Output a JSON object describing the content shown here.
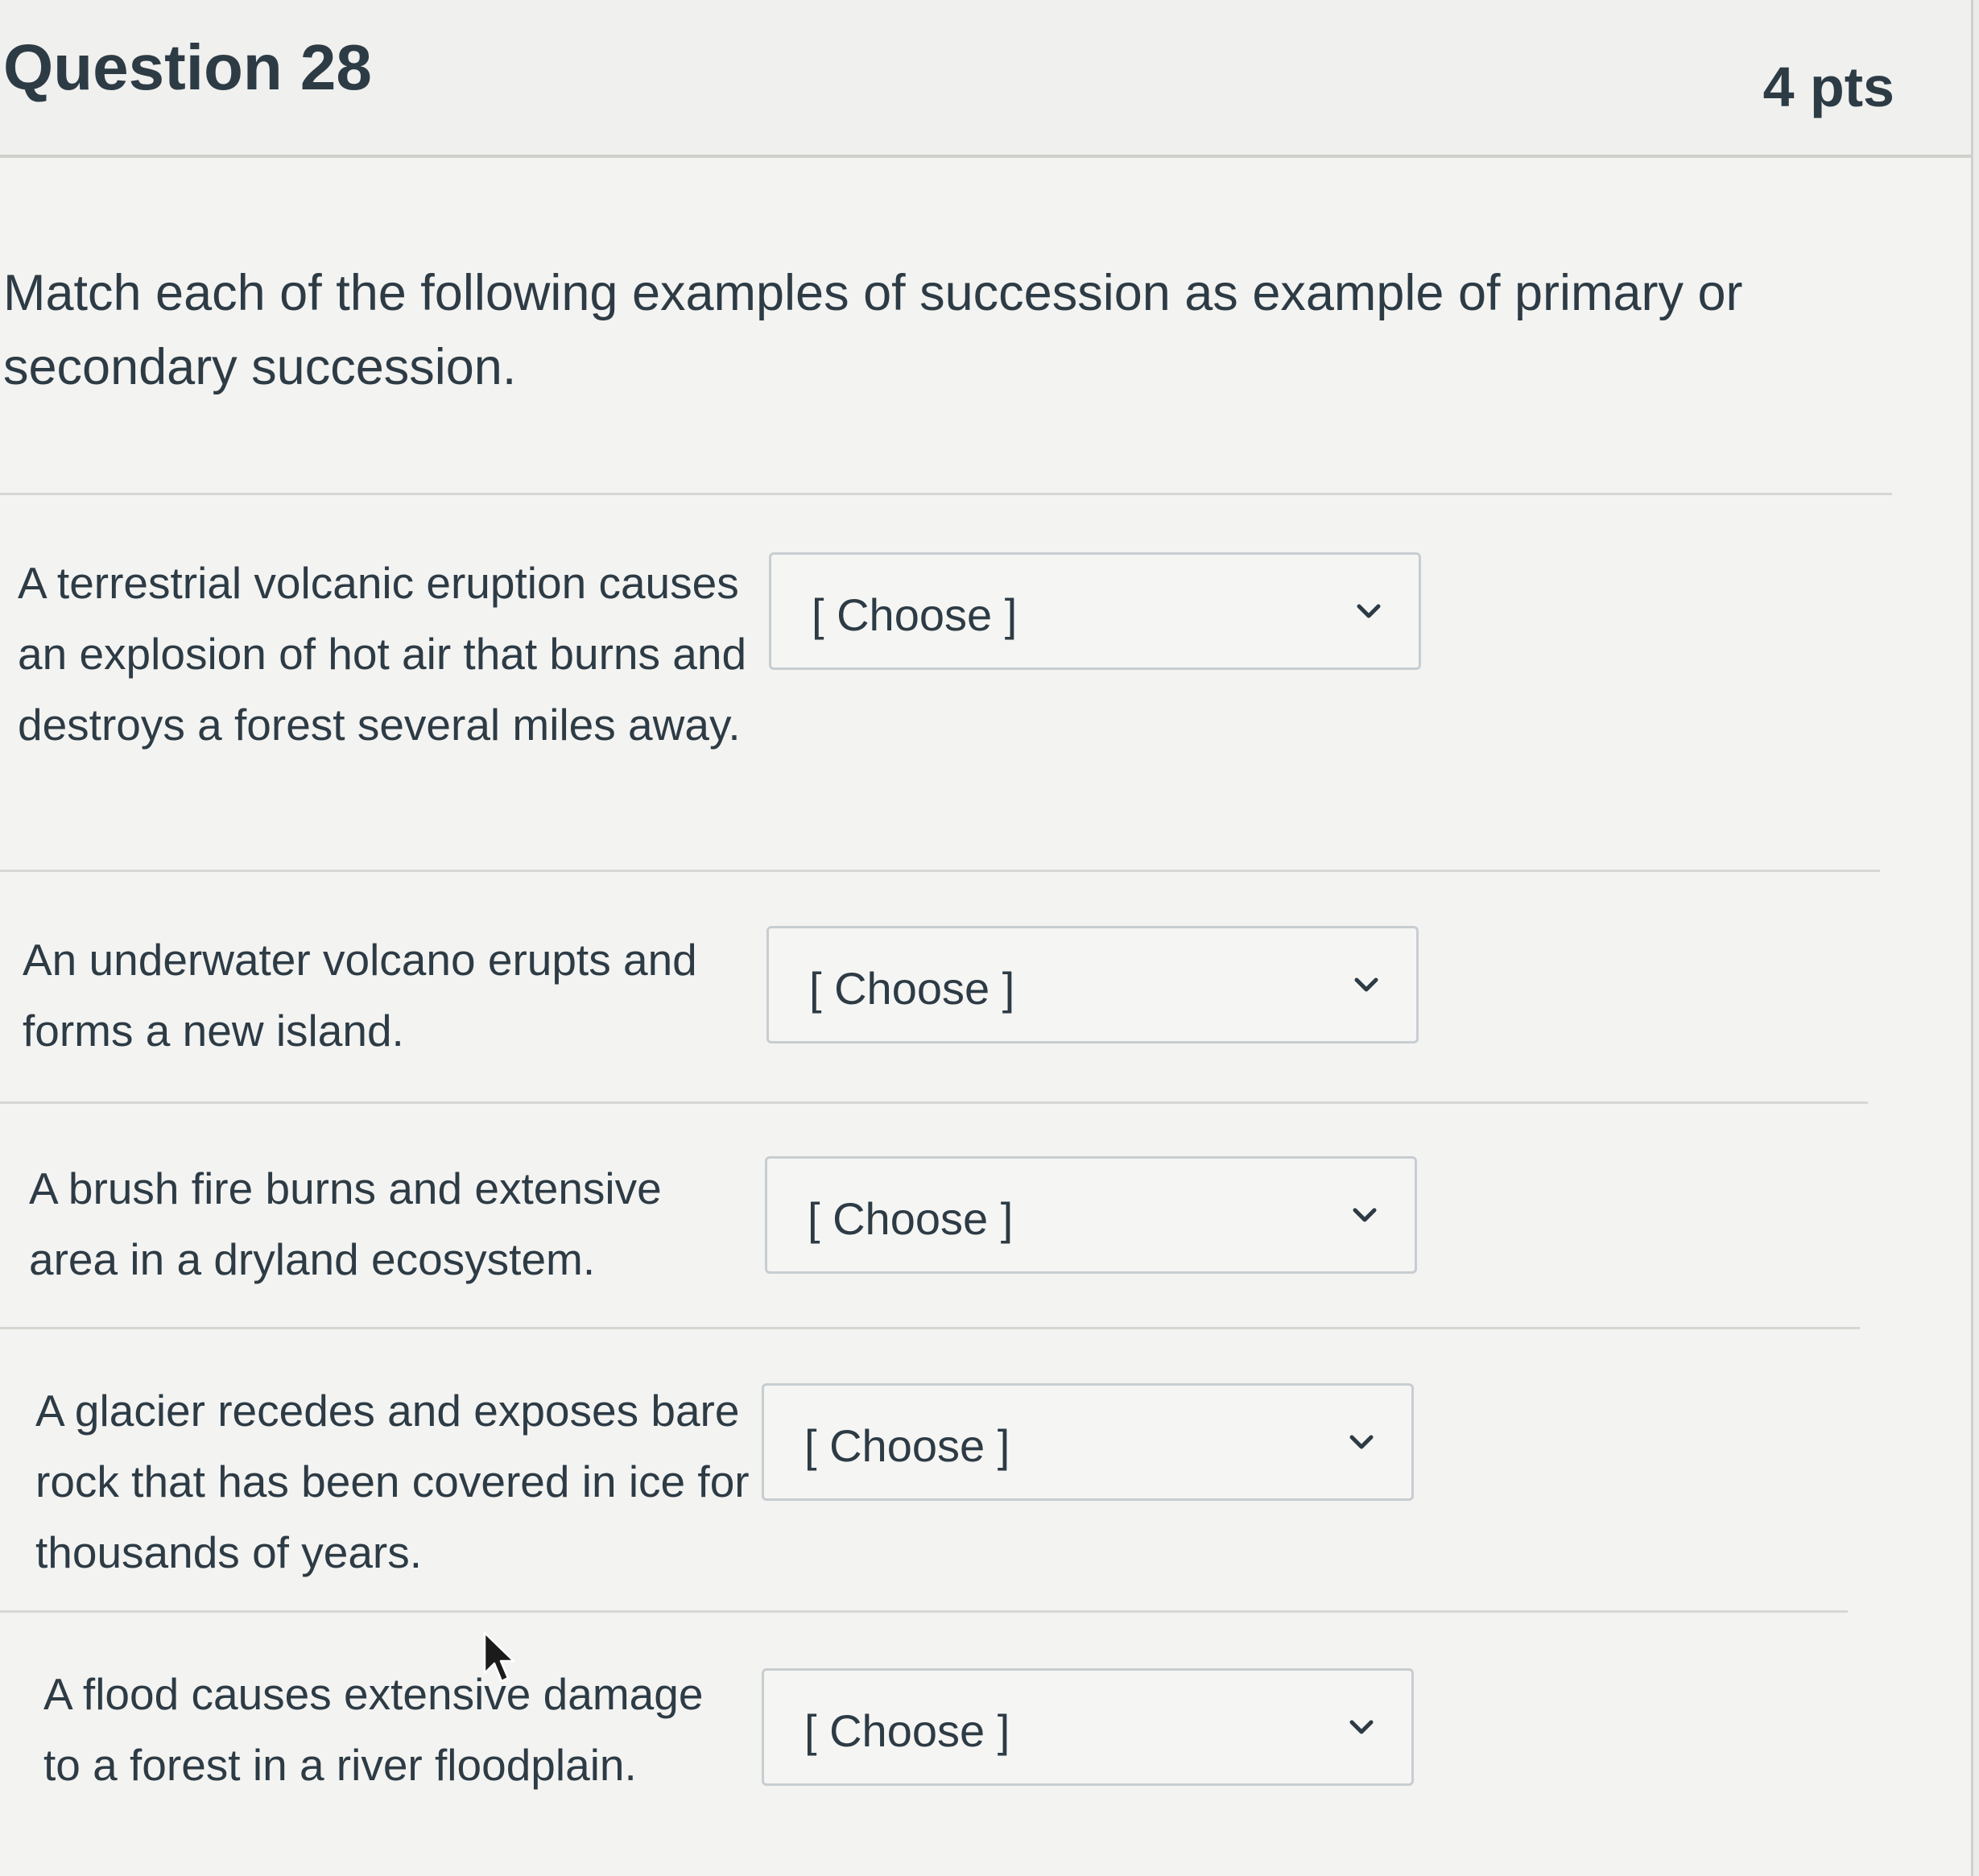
{
  "question": {
    "title": "Question 28",
    "points": "4 pts",
    "prompt": "Match each of the following examples of succession as example of primary or secondary succession."
  },
  "answers": [
    {
      "label": "A terrestrial volcanic eruption causes an explosion of hot air that burns and destroys a forest several miles away.",
      "selected": "[ Choose ]"
    },
    {
      "label": "An underwater volcano erupts and forms a new island.",
      "selected": "[ Choose ]"
    },
    {
      "label": "A brush fire burns and extensive area in a dryland ecosystem.",
      "selected": "[ Choose ]"
    },
    {
      "label": "A glacier recedes and exposes bare rock that has been covered in ice for thousands of years.",
      "selected": "[ Choose ]"
    },
    {
      "label": "A flood causes extensive damage to a forest in a river floodplain.",
      "selected": "[ Choose ]"
    }
  ],
  "icons": {
    "dropdown": "chevron-down-icon",
    "cursor": "mouse-pointer-icon"
  },
  "colors": {
    "text": "#2d3b45",
    "background": "#f3f3f1",
    "border": "#c7cdd1"
  }
}
